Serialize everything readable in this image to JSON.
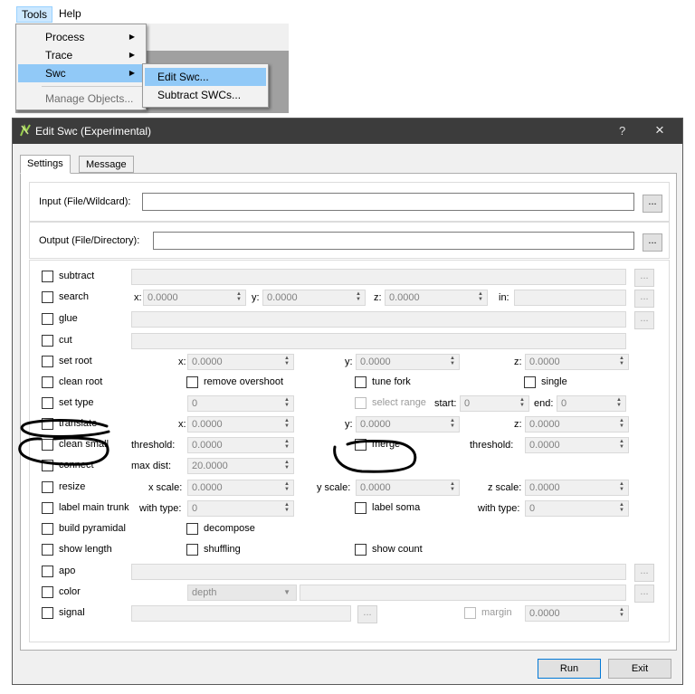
{
  "menubar": {
    "tools": "Tools",
    "help": "Help"
  },
  "tools_menu": {
    "items": [
      {
        "label": "Process",
        "has_submenu": true,
        "selected": false,
        "enabled": true
      },
      {
        "label": "Trace",
        "has_submenu": true,
        "selected": false,
        "enabled": true
      },
      {
        "label": "Swc",
        "has_submenu": true,
        "selected": true,
        "enabled": true
      },
      {
        "label": "Manage Objects...",
        "has_submenu": false,
        "selected": false,
        "enabled": false
      }
    ]
  },
  "swc_menu": {
    "items": [
      {
        "label": "Edit Swc...",
        "selected": true
      },
      {
        "label": "Subtract SWCs...",
        "selected": false
      }
    ]
  },
  "dialog": {
    "title": "Edit Swc (Experimental)",
    "help": "?",
    "close": "×",
    "tabs": [
      {
        "label": "Settings",
        "active": true
      },
      {
        "label": "Message",
        "active": false
      }
    ],
    "input": {
      "label": "Input (File/Wildcard):",
      "value": "",
      "browse": "..."
    },
    "output": {
      "label": "Output (File/Directory):",
      "value": "",
      "browse": "..."
    },
    "options": {
      "subtract": {
        "label": "subtract",
        "browse": "..."
      },
      "search": {
        "label": "search",
        "x_label": "x:",
        "x": "0.0000",
        "y_label": "y:",
        "y": "0.0000",
        "z_label": "z:",
        "z": "0.0000",
        "in_label": "in:",
        "browse": "..."
      },
      "glue": {
        "label": "glue",
        "browse": "..."
      },
      "cut": {
        "label": "cut"
      },
      "set_root": {
        "label": "set root",
        "x_label": "x:",
        "x": "0.0000",
        "y_label": "y:",
        "y": "0.0000",
        "z_label": "z:",
        "z": "0.0000"
      },
      "clean_root": {
        "label": "clean root",
        "remove_overshoot": "remove overshoot",
        "tune_fork": "tune fork",
        "single": "single"
      },
      "set_type": {
        "label": "set type",
        "type": "0",
        "select_range": "select range",
        "start_label": "start:",
        "start": "0",
        "end_label": "end:",
        "end": "0"
      },
      "translate": {
        "label": "translate",
        "x_label": "x:",
        "x": "0.0000",
        "y_label": "y:",
        "y": "0.0000",
        "z_label": "z:",
        "z": "0.0000"
      },
      "clean_small": {
        "label": "clean small",
        "threshold_label": "threshold:",
        "threshold": "0.0000",
        "merge": "merge",
        "merge_threshold_label": "threshold:",
        "merge_threshold": "0.0000"
      },
      "connect": {
        "label": "connect",
        "max_dist_label": "max dist:",
        "max_dist": "20.0000"
      },
      "resize": {
        "label": "resize",
        "x_scale_label": "x scale:",
        "x_scale": "0.0000",
        "y_scale_label": "y scale:",
        "y_scale": "0.0000",
        "z_scale_label": "z scale:",
        "z_scale": "0.0000"
      },
      "label_main_trunk": {
        "label": "label main trunk",
        "with_type_label": "with type:",
        "with_type": "0",
        "label_soma": "label soma",
        "soma_with_type_label": "with type:",
        "soma_with_type": "0"
      },
      "build_pyramidal": {
        "label": "build pyramidal",
        "decompose": "decompose"
      },
      "show_length": {
        "label": "show length",
        "shuffling": "shuffling",
        "show_count": "show count"
      },
      "apo": {
        "label": "apo",
        "browse": "..."
      },
      "color": {
        "label": "color",
        "mode": "depth",
        "browse": "..."
      },
      "signal": {
        "label": "signal",
        "browse": "...",
        "margin_label": "margin",
        "margin": "0.0000"
      }
    },
    "buttons": {
      "run": "Run",
      "exit": "Exit"
    }
  }
}
